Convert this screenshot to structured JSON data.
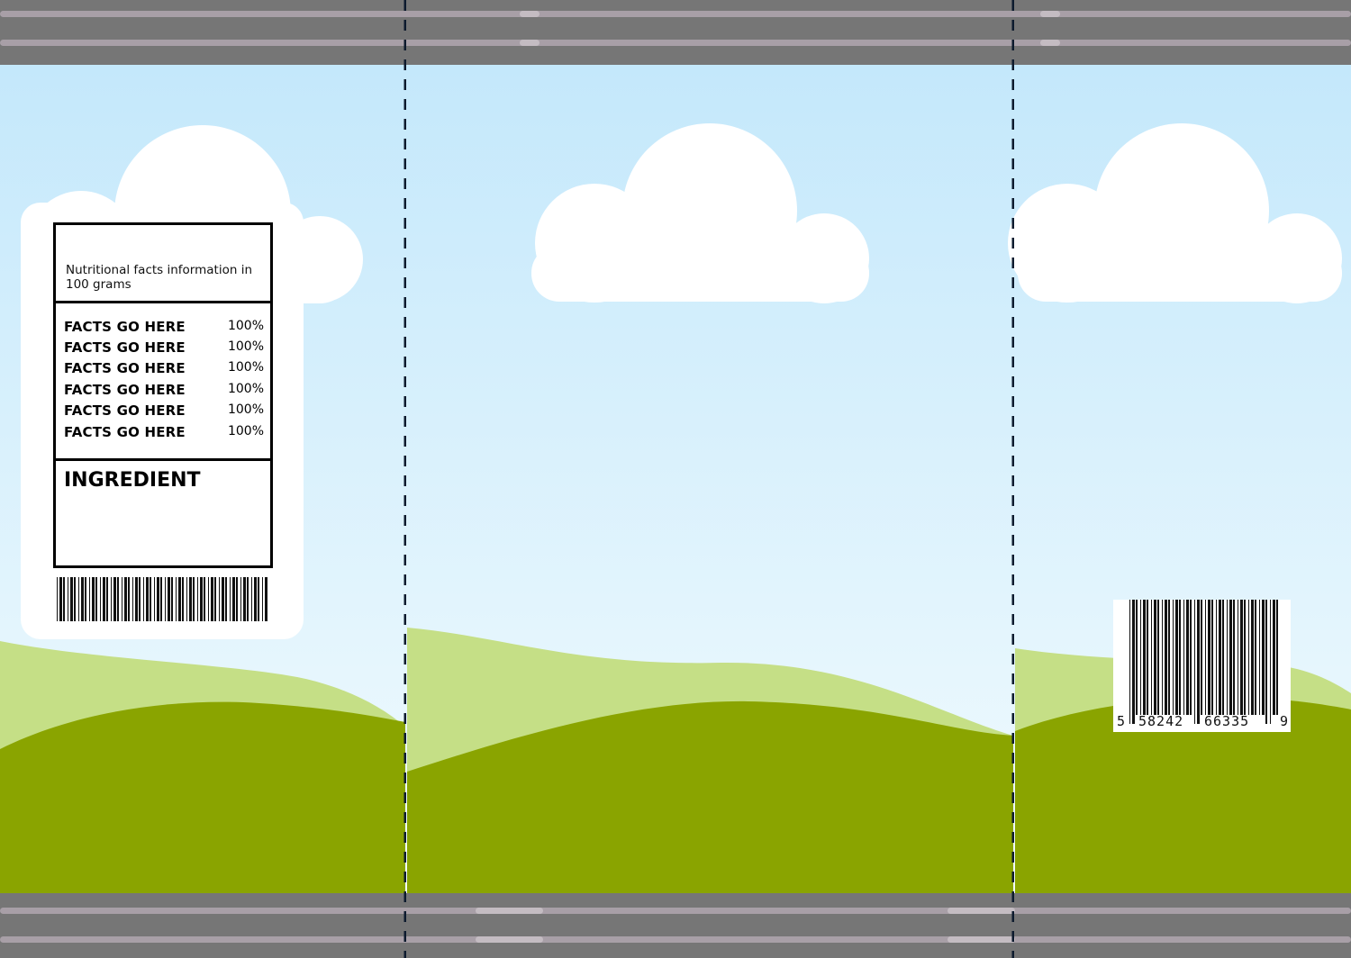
{
  "nutrition_label": {
    "header": "Nutritional facts information in 100 grams",
    "facts": [
      {
        "name": "FACTS GO HERE",
        "value": "100%"
      },
      {
        "name": "FACTS GO HERE",
        "value": "100%"
      },
      {
        "name": "FACTS GO HERE",
        "value": "100%"
      },
      {
        "name": "FACTS GO HERE",
        "value": "100%"
      },
      {
        "name": "FACTS GO HERE",
        "value": "100%"
      },
      {
        "name": "FACTS GO HERE",
        "value": "100%"
      }
    ],
    "ingredient_title": "INGREDIENT"
  },
  "barcode": {
    "digit_first": "5",
    "digits_group_1": "58242",
    "digits_group_2": "66335",
    "digit_last": "9"
  },
  "colors": {
    "sky_top": "#c4e8fb",
    "sky_bottom": "#eef9fd",
    "hill_light": "#c5df86",
    "hill_dark": "#8aa400",
    "cloud": "#ffffff",
    "strip": "#767676",
    "fold_line": "#0d1b2e"
  }
}
